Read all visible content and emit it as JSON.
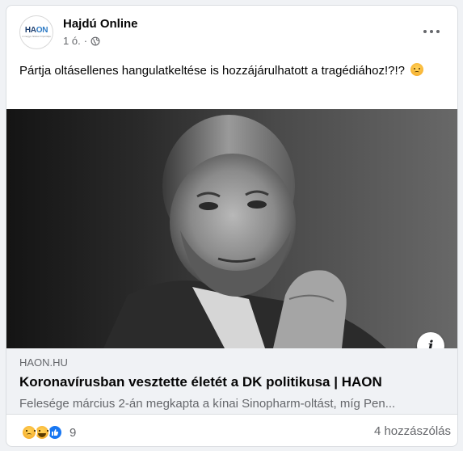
{
  "post": {
    "page_name": "Hajdú Online",
    "avatar_text_main": "HA",
    "avatar_text_accent": "ON",
    "avatar_tagline": "A megye hiteles hírportálja",
    "time": "1 ó.",
    "privacy_icon": "globe-icon",
    "text": "Pártja oltásellenes hangulatkeltése is hozzájárulhatott a tragédiához!?!?",
    "text_emoji": "angry-face-emoji"
  },
  "link_preview": {
    "domain": "HAON.HU",
    "title": "Koronavírusban vesztette életét a DK politikusa | HAON",
    "description": "Felesége március 2-án megkapta a kínai Sinopharm-oltást, míg Pen..."
  },
  "footer": {
    "reaction_icons": [
      "sad-reaction-icon",
      "haha-reaction-icon",
      "like-reaction-icon"
    ],
    "reaction_count": "9",
    "comments": "4 hozzászólás"
  },
  "colors": {
    "background": "#f0f2f5",
    "card": "#ffffff",
    "secondary_text": "#65676b",
    "like_blue": "#1877f2"
  }
}
